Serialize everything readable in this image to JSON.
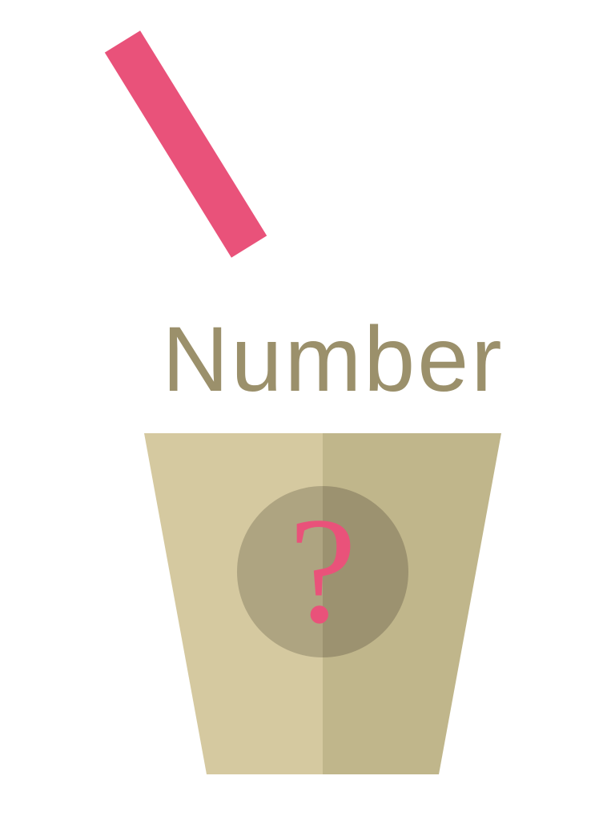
{
  "game": {
    "title": "Number",
    "answer_placeholder": "?"
  },
  "colors": {
    "background": "#FFFFFF",
    "straw": "#E9527A",
    "title_text": "#9B906B",
    "cup_left": "#D5C9A0",
    "cup_right": "#C0B68B",
    "badge_left": "#AEA481",
    "badge_right": "#9C9270",
    "question_mark": "#E9527A"
  },
  "icons": {
    "straw": "straw-icon",
    "cup": "cup-icon",
    "badge": "question-badge-icon"
  }
}
